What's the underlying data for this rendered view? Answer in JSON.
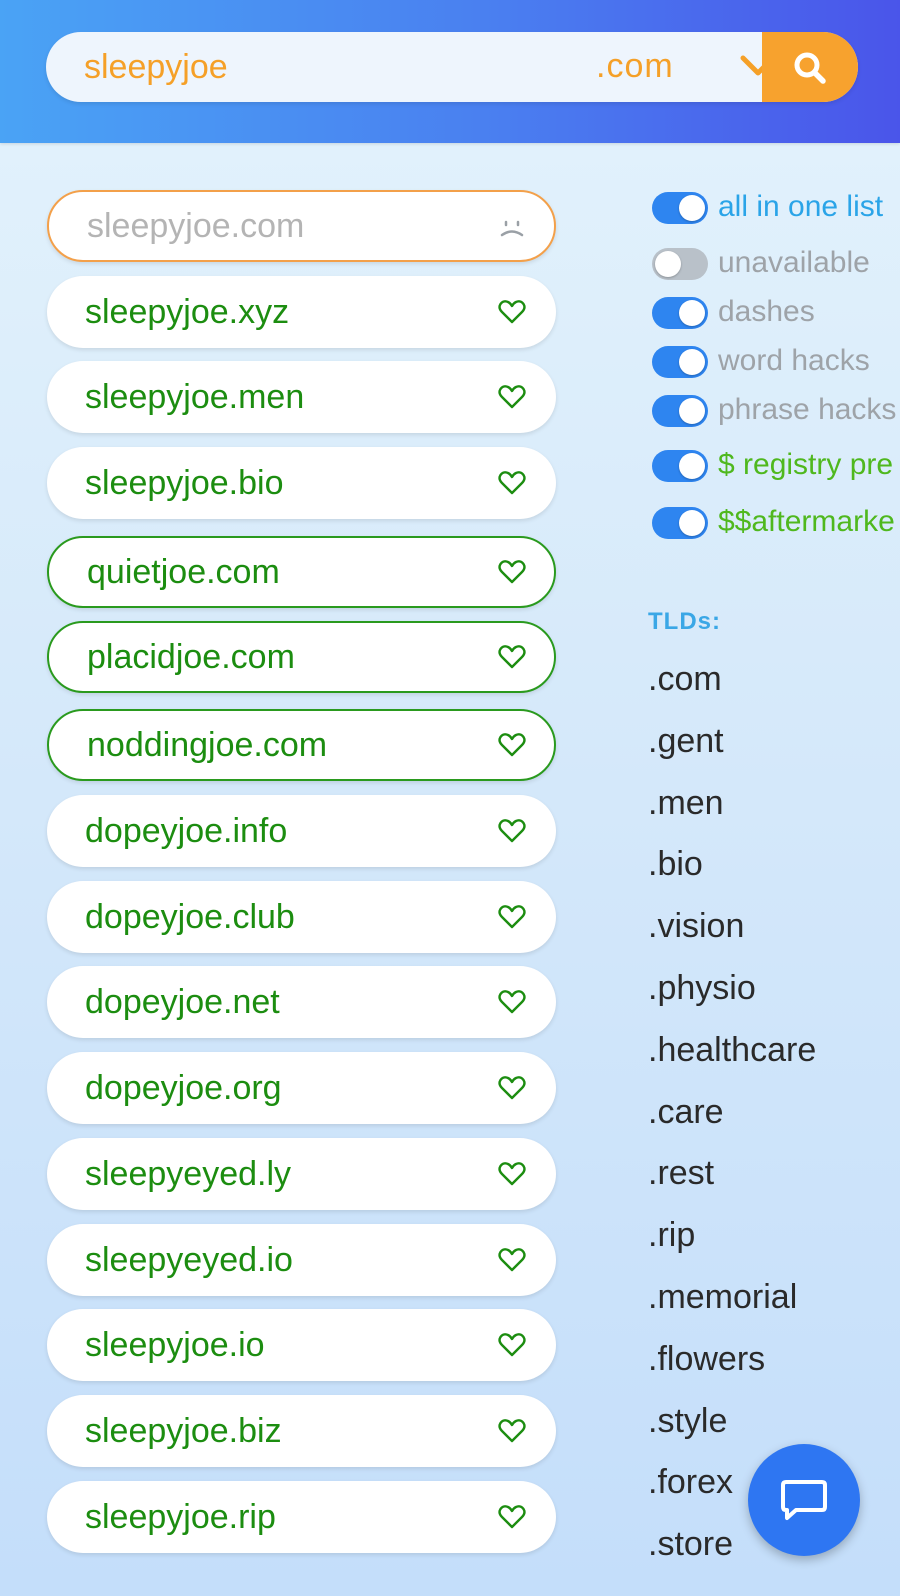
{
  "search": {
    "query": "sleepyjoe",
    "tld": ".com"
  },
  "results": [
    {
      "domain": "sleepyjoe.com",
      "status": "taken",
      "icon": "frown-icon"
    },
    {
      "domain": "sleepyjoe.xyz",
      "status": "available",
      "icon": "heart-icon"
    },
    {
      "domain": "sleepyjoe.men",
      "status": "available",
      "icon": "heart-icon"
    },
    {
      "domain": "sleepyjoe.bio",
      "status": "available",
      "icon": "heart-icon"
    },
    {
      "domain": "quietjoe.com",
      "status": "featured",
      "icon": "heart-icon"
    },
    {
      "domain": "placidjoe.com",
      "status": "featured",
      "icon": "heart-icon"
    },
    {
      "domain": "noddingjoe.com",
      "status": "featured",
      "icon": "heart-icon"
    },
    {
      "domain": "dopeyjoe.info",
      "status": "available",
      "icon": "heart-icon"
    },
    {
      "domain": "dopeyjoe.club",
      "status": "available",
      "icon": "heart-icon"
    },
    {
      "domain": "dopeyjoe.net",
      "status": "available",
      "icon": "heart-icon"
    },
    {
      "domain": "dopeyjoe.org",
      "status": "available",
      "icon": "heart-icon"
    },
    {
      "domain": "sleepyeyed.ly",
      "status": "available",
      "icon": "heart-icon"
    },
    {
      "domain": "sleepyeyed.io",
      "status": "available",
      "icon": "heart-icon"
    },
    {
      "domain": "sleepyjoe.io",
      "status": "available",
      "icon": "heart-icon"
    },
    {
      "domain": "sleepyjoe.biz",
      "status": "available",
      "icon": "heart-icon"
    },
    {
      "domain": "sleepyjoe.rip",
      "status": "available",
      "icon": "heart-icon"
    }
  ],
  "filters": [
    {
      "label": "all in one list",
      "on": true
    },
    {
      "label": "unavailable",
      "on": false
    },
    {
      "label": "dashes",
      "on": true
    },
    {
      "label": "word hacks",
      "on": true
    },
    {
      "label": "phrase hacks",
      "on": true
    },
    {
      "label": "$ registry pre",
      "on": true
    },
    {
      "label": "$$aftermarke",
      "on": true
    }
  ],
  "tlds": {
    "heading": "TLDs:",
    "items": [
      ".com",
      ".gent",
      ".men",
      ".bio",
      ".vision",
      ".physio",
      ".healthcare",
      ".care",
      ".rest",
      ".rip",
      ".memorial",
      ".flowers",
      ".style",
      ".forex",
      ".store"
    ]
  },
  "colors": {
    "accent_orange": "#f7a22e",
    "available_green": "#1c8d10",
    "toggle_blue": "#2e85f0",
    "header_gradient_start": "#4aa3f5",
    "header_gradient_end": "#4a55ea"
  }
}
